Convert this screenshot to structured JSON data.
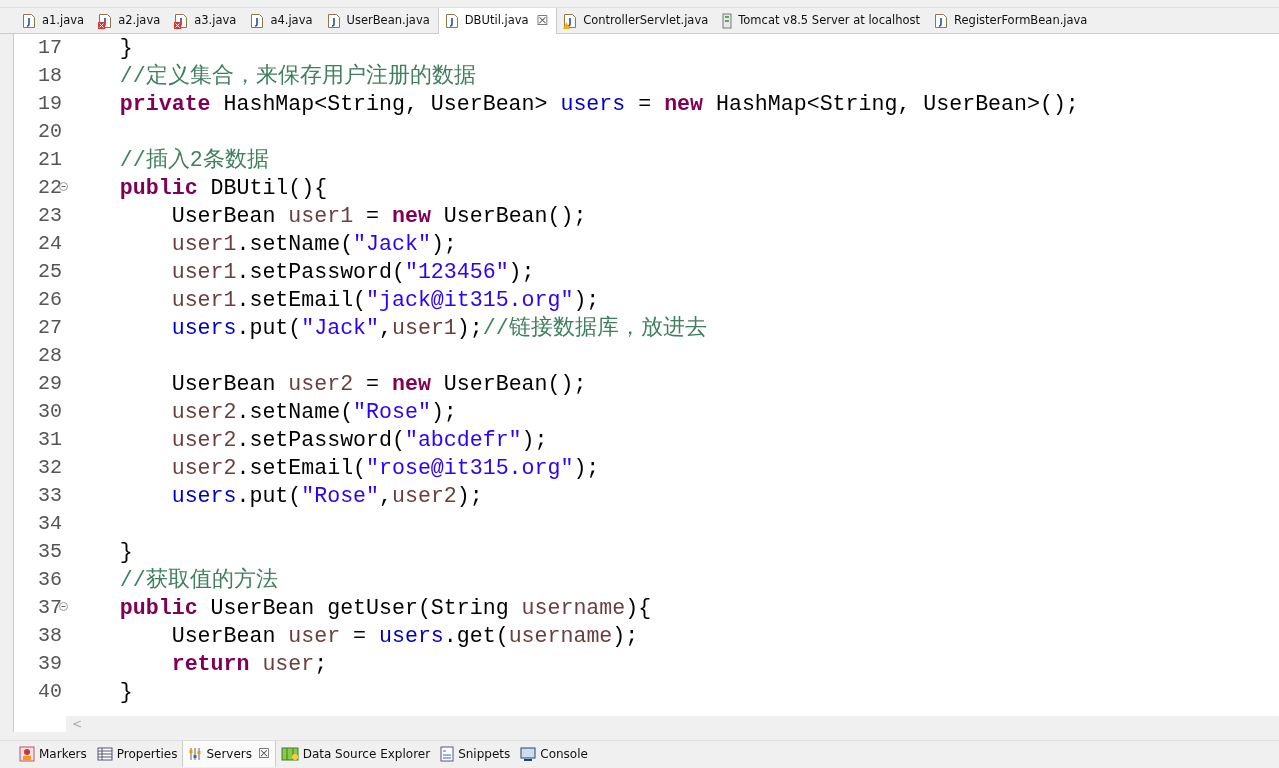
{
  "editor_tabs": [
    {
      "label": "a1.java",
      "kind": "java",
      "selected": false
    },
    {
      "label": "a2.java",
      "kind": "java-error",
      "selected": false
    },
    {
      "label": "a3.java",
      "kind": "java-error",
      "selected": false
    },
    {
      "label": "a4.java",
      "kind": "java",
      "selected": false
    },
    {
      "label": "UserBean.java",
      "kind": "java",
      "selected": false
    },
    {
      "label": "DBUtil.java",
      "kind": "java",
      "selected": true,
      "close": "☒"
    },
    {
      "label": "ControllerServlet.java",
      "kind": "java-warning",
      "selected": false
    },
    {
      "label": "Tomcat v8.5 Server at localhost",
      "kind": "server",
      "selected": false
    },
    {
      "label": "RegisterFormBean.java",
      "kind": "java",
      "selected": false
    }
  ],
  "code_lines": [
    {
      "number": "17",
      "fold": false,
      "tokens": [
        {
          "kind": "plain",
          "t": "    }"
        }
      ]
    },
    {
      "number": "18",
      "fold": false,
      "tokens": [
        {
          "kind": "comment",
          "t": "    //定义集合，来保存用户注册的数据"
        }
      ]
    },
    {
      "number": "19",
      "fold": false,
      "tokens": [
        {
          "kind": "kw",
          "t": "    private"
        },
        {
          "kind": "plain",
          "t": " HashMap<String, UserBean> "
        },
        {
          "kind": "field",
          "t": "users"
        },
        {
          "kind": "plain",
          "t": " = "
        },
        {
          "kind": "kw",
          "t": "new"
        },
        {
          "kind": "plain",
          "t": " HashMap<String, UserBean>();"
        }
      ]
    },
    {
      "number": "20",
      "fold": false
    },
    {
      "number": "21",
      "fold": false,
      "tokens": [
        {
          "kind": "comment",
          "t": "    //插入2条数据"
        }
      ]
    },
    {
      "number": "22",
      "fold": true,
      "tokens": [
        {
          "kind": "kw",
          "t": "    public"
        },
        {
          "kind": "plain",
          "t": " DBUtil(){"
        }
      ]
    },
    {
      "number": "23",
      "fold": false,
      "tokens": [
        {
          "kind": "plain",
          "t": "        UserBean "
        },
        {
          "kind": "local",
          "t": "user1"
        },
        {
          "kind": "plain",
          "t": " = "
        },
        {
          "kind": "kw",
          "t": "new"
        },
        {
          "kind": "plain",
          "t": " UserBean();"
        }
      ]
    },
    {
      "number": "24",
      "fold": false,
      "tokens": [
        {
          "kind": "local",
          "t": "        user1"
        },
        {
          "kind": "plain",
          "t": ".setName("
        },
        {
          "kind": "str",
          "t": "\"Jack\""
        },
        {
          "kind": "plain",
          "t": ");"
        }
      ]
    },
    {
      "number": "25",
      "fold": false,
      "tokens": [
        {
          "kind": "local",
          "t": "        user1"
        },
        {
          "kind": "plain",
          "t": ".setPassword("
        },
        {
          "kind": "str",
          "t": "\"123456\""
        },
        {
          "kind": "plain",
          "t": ");"
        }
      ]
    },
    {
      "number": "26",
      "fold": false,
      "tokens": [
        {
          "kind": "local",
          "t": "        user1"
        },
        {
          "kind": "plain",
          "t": ".setEmail("
        },
        {
          "kind": "str",
          "t": "\"jack@it315.org\""
        },
        {
          "kind": "plain",
          "t": ");"
        }
      ]
    },
    {
      "number": "27",
      "fold": false,
      "tokens": [
        {
          "kind": "field",
          "t": "        users"
        },
        {
          "kind": "plain",
          "t": ".put("
        },
        {
          "kind": "str",
          "t": "\"Jack\""
        },
        {
          "kind": "plain",
          "t": ","
        },
        {
          "kind": "local",
          "t": "user1"
        },
        {
          "kind": "plain",
          "t": ");"
        },
        {
          "kind": "comment",
          "t": "//链接数据库，放进去"
        }
      ]
    },
    {
      "number": "28",
      "fold": false
    },
    {
      "number": "29",
      "fold": false,
      "tokens": [
        {
          "kind": "plain",
          "t": "        UserBean "
        },
        {
          "kind": "local",
          "t": "user2"
        },
        {
          "kind": "plain",
          "t": " = "
        },
        {
          "kind": "kw",
          "t": "new"
        },
        {
          "kind": "plain",
          "t": " UserBean();"
        }
      ]
    },
    {
      "number": "30",
      "fold": false,
      "tokens": [
        {
          "kind": "local",
          "t": "        user2"
        },
        {
          "kind": "plain",
          "t": ".setName("
        },
        {
          "kind": "str",
          "t": "\"Rose\""
        },
        {
          "kind": "plain",
          "t": ");"
        }
      ]
    },
    {
      "number": "31",
      "fold": false,
      "tokens": [
        {
          "kind": "local",
          "t": "        user2"
        },
        {
          "kind": "plain",
          "t": ".setPassword("
        },
        {
          "kind": "str",
          "t": "\"abcdefr\""
        },
        {
          "kind": "plain",
          "t": ");"
        }
      ]
    },
    {
      "number": "32",
      "fold": false,
      "tokens": [
        {
          "kind": "local",
          "t": "        user2"
        },
        {
          "kind": "plain",
          "t": ".setEmail("
        },
        {
          "kind": "str",
          "t": "\"rose@it315.org\""
        },
        {
          "kind": "plain",
          "t": ");"
        }
      ]
    },
    {
      "number": "33",
      "fold": false,
      "tokens": [
        {
          "kind": "field",
          "t": "        users"
        },
        {
          "kind": "plain",
          "t": ".put("
        },
        {
          "kind": "str",
          "t": "\"Rose\""
        },
        {
          "kind": "plain",
          "t": ","
        },
        {
          "kind": "local",
          "t": "user2"
        },
        {
          "kind": "plain",
          "t": ");"
        }
      ]
    },
    {
      "number": "34",
      "fold": false
    },
    {
      "number": "35",
      "fold": false,
      "tokens": [
        {
          "kind": "plain",
          "t": "    }"
        }
      ]
    },
    {
      "number": "36",
      "fold": false,
      "tokens": [
        {
          "kind": "comment",
          "t": "    //获取值的方法"
        }
      ]
    },
    {
      "number": "37",
      "fold": true,
      "tokens": [
        {
          "kind": "kw",
          "t": "    public"
        },
        {
          "kind": "plain",
          "t": " UserBean getUser(String "
        },
        {
          "kind": "local",
          "t": "username"
        },
        {
          "kind": "plain",
          "t": "){"
        }
      ]
    },
    {
      "number": "38",
      "fold": false,
      "tokens": [
        {
          "kind": "plain",
          "t": "        UserBean "
        },
        {
          "kind": "local",
          "t": "user"
        },
        {
          "kind": "plain",
          "t": " = "
        },
        {
          "kind": "field",
          "t": "users"
        },
        {
          "kind": "plain",
          "t": ".get("
        },
        {
          "kind": "local",
          "t": "username"
        },
        {
          "kind": "plain",
          "t": ");"
        }
      ]
    },
    {
      "number": "39",
      "fold": false,
      "tokens": [
        {
          "kind": "kw",
          "t": "        return"
        },
        {
          "kind": "local",
          "t": " user"
        },
        {
          "kind": "plain",
          "t": ";"
        }
      ]
    },
    {
      "number": "40",
      "fold": false,
      "tokens": [
        {
          "kind": "plain",
          "t": "    }"
        }
      ]
    }
  ],
  "scroll_left_glyph": "<",
  "view_tabs": [
    {
      "label": "Markers",
      "kind": "markers",
      "selected": false
    },
    {
      "label": "Properties",
      "kind": "properties",
      "selected": false
    },
    {
      "label": "Servers",
      "kind": "servers",
      "selected": true,
      "close": "☒"
    },
    {
      "label": "Data Source Explorer",
      "kind": "datasource",
      "selected": false
    },
    {
      "label": "Snippets",
      "kind": "snippets",
      "selected": false
    },
    {
      "label": "Console",
      "kind": "console",
      "selected": false
    }
  ]
}
